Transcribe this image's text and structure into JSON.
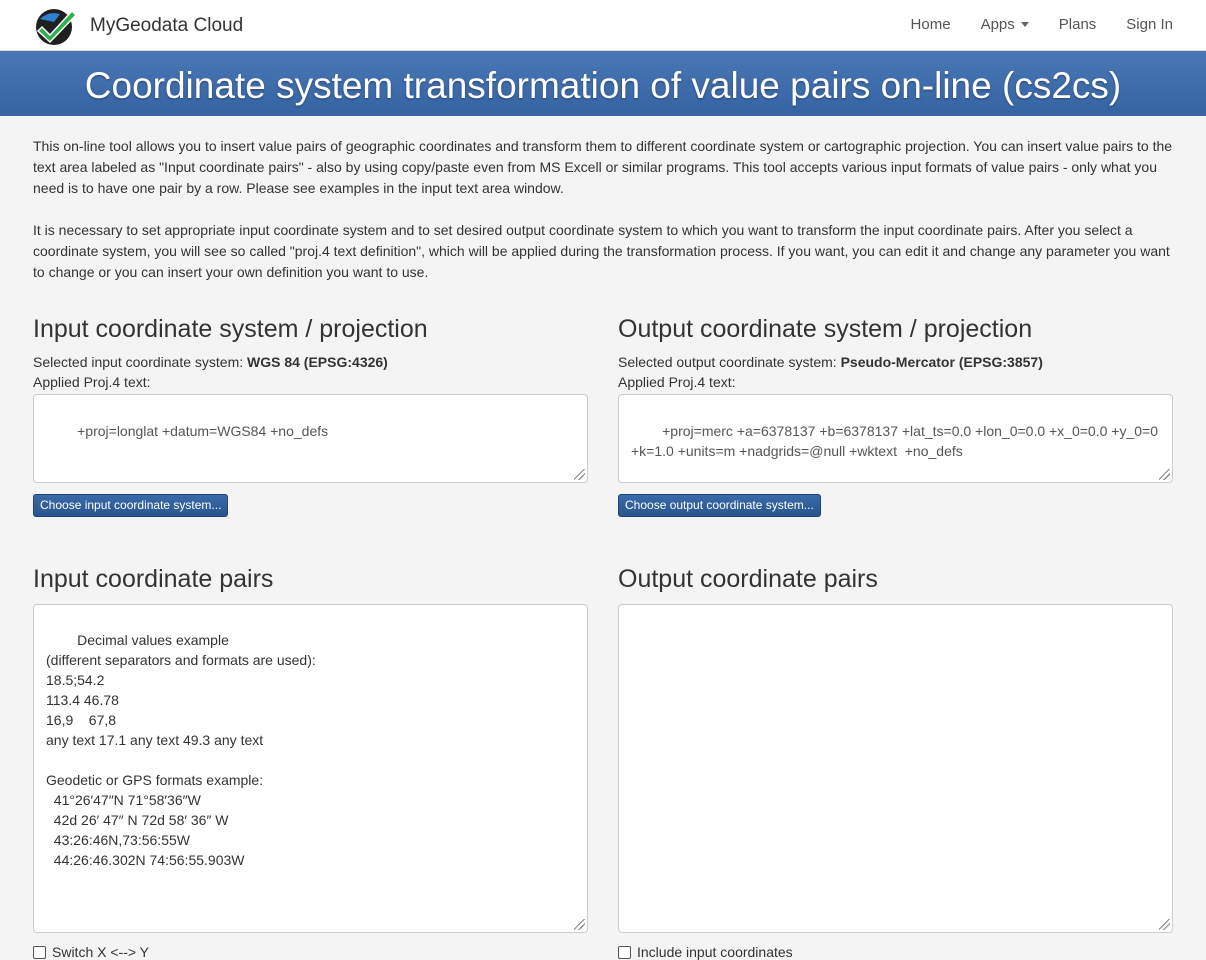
{
  "nav": {
    "brand": "MyGeodata Cloud",
    "links": [
      {
        "label": "Home"
      },
      {
        "label": "Apps"
      },
      {
        "label": "Plans"
      },
      {
        "label": "Sign In"
      }
    ]
  },
  "banner": {
    "title": "Coordinate system transformation of value pairs on-line (cs2cs)"
  },
  "intro": {
    "p1": "This on-line tool allows you to insert value pairs of geographic coordinates and transform them to different coordinate system or cartographic projection. You can insert value pairs to the text area labeled as \"Input coordinate pairs\" - also by using copy/paste even from MS Excell or similar programs. This tool accepts various input formats of value pairs - only what you need is to have one pair by a row. Please see examples in the input text area window.",
    "p2": "It is necessary to set appropriate input coordinate system and to set desired output coordinate system to which you want to transform the input coordinate pairs. After you select a coordinate system, you will see so called \"proj.4 text definition\", which will be applied during the transformation process. If you want, you can edit it and change any parameter you want to change or you can insert your own definition you want to use."
  },
  "input_cs": {
    "title": "Input coordinate system / projection",
    "selected_label": "Selected input coordinate system: ",
    "selected_value": "WGS 84 (EPSG:4326)",
    "applied_label": "Applied Proj.4 text:",
    "proj_text": "+proj=longlat +datum=WGS84 +no_defs",
    "button": "Choose input coordinate system..."
  },
  "output_cs": {
    "title": "Output coordinate system / projection",
    "selected_label": "Selected output coordinate system: ",
    "selected_value": "Pseudo-Mercator (EPSG:3857)",
    "applied_label": "Applied Proj.4 text:",
    "proj_text": "+proj=merc +a=6378137 +b=6378137 +lat_ts=0.0 +lon_0=0.0 +x_0=0.0 +y_0=0 +k=1.0 +units=m +nadgrids=@null +wktext  +no_defs",
    "button": "Choose output coordinate system..."
  },
  "input_pairs": {
    "title": "Input coordinate pairs",
    "placeholder": "Decimal values example\n(different separators and formats are used):\n18.5;54.2\n113.4 46.78\n16,9    67,8\nany text 17.1 any text 49.3 any text\n\nGeodetic or GPS formats example:\n  41°26′47″N 71°58′36″W\n  42d 26′ 47″ N 72d 58′ 36″ W\n  43:26:46N,73:56:55W\n  44:26:46.302N 74:56:55.903W",
    "switch_label": "Switch X <--> Y"
  },
  "output_pairs": {
    "title": "Output coordinate pairs",
    "value": "",
    "include_label": "Include input coordinates"
  },
  "colors": {
    "banner": "#3a68a8",
    "button": "#2d5a96",
    "logo_check": "#2bb24c"
  }
}
